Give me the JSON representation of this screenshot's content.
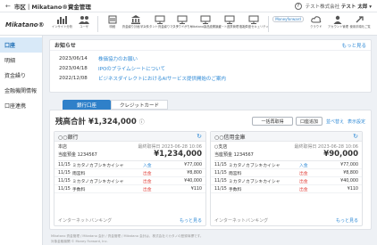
{
  "topbar": {
    "back": "←",
    "title": "市区｜Mikatano®資金管理",
    "help": "?",
    "user_note": "テスト株式会社",
    "user_name": "テスト 太郎 ▾"
  },
  "brand": "Mikatano®",
  "toolbar": {
    "items": [
      {
        "label": "インサイト分析",
        "icon": "chart-icon"
      },
      {
        "label": "ユーザ",
        "icon": "users-icon"
      },
      {
        "label": "明細",
        "icon": "document-icon"
      },
      {
        "label": "資金繰り計画マスタ",
        "icon": "bank-icon"
      },
      {
        "label": "インスタント資金繰りマスタ",
        "icon": "monitor-icon"
      },
      {
        "label": "クラウドがちゃ",
        "icon": "pc-icon"
      },
      {
        "label": "Mikatano製品連携設定",
        "icon": "monitor-icon"
      },
      {
        "label": "インポート連携管理マスタ",
        "icon": "monitor-icon"
      },
      {
        "label": "自社口座セキュリティ",
        "icon": "monitor-icon"
      }
    ],
    "pill": "Moneyforward",
    "right": [
      {
        "label": "クラウド",
        "icon": "cloud-icon"
      },
      {
        "label": "アカウント管理",
        "icon": "person-icon"
      },
      {
        "label": "使用手順をご覧",
        "icon": "link-icon"
      }
    ]
  },
  "sidebar": {
    "items": [
      "口座",
      "明細",
      "資金繰り",
      "金融機関情報",
      "口座連携"
    ]
  },
  "notice": {
    "title": "お知らせ",
    "more": "もっと見る",
    "items": [
      {
        "date": "2023/06/14",
        "text": "株価協力のお願い"
      },
      {
        "date": "2023/04/18",
        "text": "IPOのプライムシートについて"
      },
      {
        "date": "2022/12/08",
        "text": "ビジネスダイレクトにおけるAIサービス提供開始のご案内"
      }
    ]
  },
  "tabs": {
    "bank": "銀行口座",
    "card": "クレジットカード"
  },
  "summary": {
    "label": "残高合計 ¥1,324,000",
    "icon": "info-icon",
    "btn_batch": "一括再取得",
    "btn_add": "口座追加",
    "link_sort": "並べ替え",
    "link_hidden": "表示設定"
  },
  "accounts": [
    {
      "name": "○○銀行",
      "branch": "本店",
      "updated": "最終取得日 2023-06-28 10:06",
      "number": "当座預金 1234567",
      "balance": "¥1,234,000",
      "tx": [
        {
          "date": "11/15",
          "desc": "ミカタノカブシキカイシャ",
          "kind": "入金",
          "dir": "in",
          "amt": "¥77,000"
        },
        {
          "date": "11/15",
          "desc": "雨宮料",
          "kind": "出金",
          "dir": "out",
          "amt": "¥8,800"
        },
        {
          "date": "11/15",
          "desc": "ミカタノカブシキカイシャ",
          "kind": "出金",
          "dir": "out",
          "amt": "¥40,000"
        },
        {
          "date": "11/15",
          "desc": "手数料",
          "kind": "出金",
          "dir": "out",
          "amt": "¥110"
        }
      ],
      "footer": "インターネットバンキング",
      "more": "もっと見る"
    },
    {
      "name": "○○信用金庫",
      "branch": "○支店",
      "updated": "最終取得日 2023-06-28 10:06",
      "number": "当座預金 1234567",
      "balance": "¥90,000",
      "tx": [
        {
          "date": "11/15",
          "desc": "ミカタノカブシキカイシャ",
          "kind": "入金",
          "dir": "in",
          "amt": "¥77,000"
        },
        {
          "date": "11/15",
          "desc": "雨宮料",
          "kind": "出金",
          "dir": "out",
          "amt": "¥8,800"
        },
        {
          "date": "11/15",
          "desc": "ミカタノカブシキカイシャ",
          "kind": "出金",
          "dir": "out",
          "amt": "¥40,000"
        },
        {
          "date": "11/15",
          "desc": "手数料",
          "kind": "出金",
          "dir": "out",
          "amt": "¥110"
        }
      ],
      "footer": "インターネットバンキング",
      "more": "もっと見る"
    }
  ],
  "footer": {
    "line1": "Mikatano 資金管理 / Mikatano 会計 / 資金管理 / Mikatano 会計は、株式会社ミカタノの登録商標です。",
    "line2": "対象金融機関 © Money Forward, Inc."
  },
  "colors": {
    "accent": "#2f80c9",
    "link": "#2f8ad6",
    "outflow": "#e0423b",
    "sidebar_active": "#d8e9f8"
  }
}
